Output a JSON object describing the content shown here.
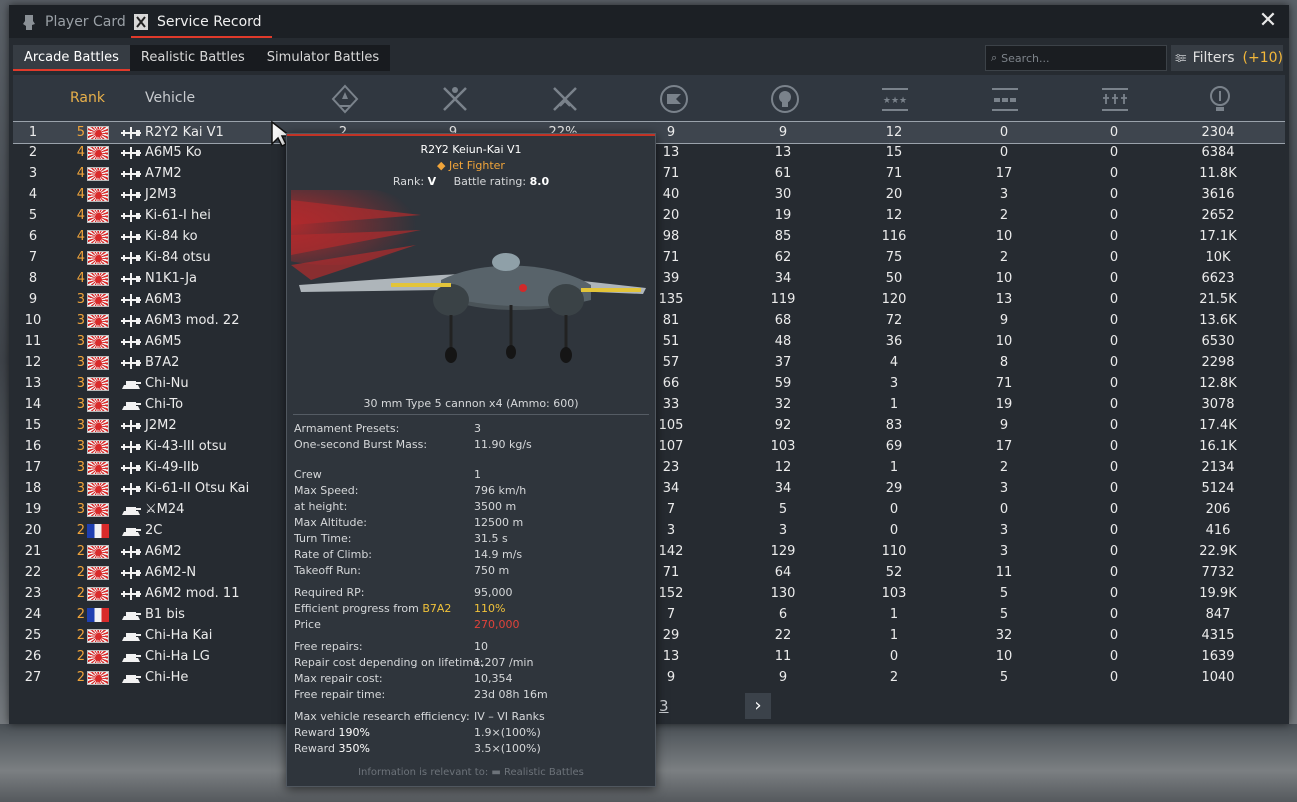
{
  "tabs": {
    "player_card": "Player Card",
    "service_record": "Service Record"
  },
  "modes": [
    "Arcade Battles",
    "Realistic Battles",
    "Simulator Battles"
  ],
  "search": {
    "placeholder": "Search..."
  },
  "filters": {
    "label": "Filters",
    "count": "(+10)"
  },
  "columns": {
    "rank": "Rank",
    "vehicle": "Vehicle",
    "icons": [
      "respawns-icon",
      "victories-icon",
      "win-rate-icon",
      "missions-icon",
      "deaths-icon",
      "air-kills-icon",
      "ground-kills-icon",
      "naval-kills-icon",
      "score-icon"
    ]
  },
  "colors": {
    "accent_red": "#e03a2b",
    "rank_orange": "#f0a43a",
    "filters_count": "#f4b83a"
  },
  "rows": [
    {
      "n": "1",
      "rank": "5",
      "flag": "jp",
      "type": "plane",
      "name": "R2Y2 Kai V1",
      "v": [
        "2",
        "9",
        "22%",
        "9",
        "9",
        "12",
        "0",
        "0",
        "2304"
      ]
    },
    {
      "n": "2",
      "rank": "4",
      "flag": "jp",
      "type": "plane",
      "name": "A6M5 Ko",
      "v": [
        "",
        "",
        "",
        "13",
        "13",
        "15",
        "0",
        "0",
        "6384"
      ]
    },
    {
      "n": "3",
      "rank": "4",
      "flag": "jp",
      "type": "plane",
      "name": "A7M2",
      "v": [
        "",
        "",
        "",
        "71",
        "61",
        "71",
        "17",
        "0",
        "11.8K"
      ]
    },
    {
      "n": "4",
      "rank": "4",
      "flag": "jp",
      "type": "plane",
      "name": "J2M3",
      "v": [
        "",
        "",
        "",
        "40",
        "30",
        "20",
        "3",
        "0",
        "3616"
      ]
    },
    {
      "n": "5",
      "rank": "4",
      "flag": "jp",
      "type": "plane",
      "name": "Ki-61-I hei",
      "v": [
        "",
        "",
        "",
        "20",
        "19",
        "12",
        "2",
        "0",
        "2652"
      ]
    },
    {
      "n": "6",
      "rank": "4",
      "flag": "jp",
      "type": "plane",
      "name": "Ki-84 ko",
      "v": [
        "",
        "",
        "",
        "98",
        "85",
        "116",
        "10",
        "0",
        "17.1K"
      ]
    },
    {
      "n": "7",
      "rank": "4",
      "flag": "jp",
      "type": "plane",
      "name": "Ki-84 otsu",
      "v": [
        "",
        "",
        "",
        "71",
        "62",
        "75",
        "2",
        "0",
        "10K"
      ]
    },
    {
      "n": "8",
      "rank": "4",
      "flag": "jp",
      "type": "plane",
      "name": "N1K1-Ja",
      "v": [
        "",
        "",
        "",
        "39",
        "34",
        "50",
        "10",
        "0",
        "6623"
      ]
    },
    {
      "n": "9",
      "rank": "3",
      "flag": "jp",
      "type": "plane",
      "name": "A6M3",
      "v": [
        "",
        "",
        "",
        "135",
        "119",
        "120",
        "13",
        "0",
        "21.5K"
      ]
    },
    {
      "n": "10",
      "rank": "3",
      "flag": "jp",
      "type": "plane",
      "name": "A6M3 mod. 22",
      "v": [
        "",
        "",
        "",
        "81",
        "68",
        "72",
        "9",
        "0",
        "13.6K"
      ]
    },
    {
      "n": "11",
      "rank": "3",
      "flag": "jp",
      "type": "plane",
      "name": "A6M5",
      "v": [
        "",
        "",
        "",
        "51",
        "48",
        "36",
        "10",
        "0",
        "6530"
      ]
    },
    {
      "n": "12",
      "rank": "3",
      "flag": "jp",
      "type": "plane",
      "name": "B7A2",
      "v": [
        "",
        "",
        "",
        "57",
        "37",
        "4",
        "8",
        "0",
        "2298"
      ]
    },
    {
      "n": "13",
      "rank": "3",
      "flag": "jp",
      "type": "tank",
      "name": "Chi-Nu",
      "v": [
        "",
        "",
        "",
        "66",
        "59",
        "3",
        "71",
        "0",
        "12.8K"
      ]
    },
    {
      "n": "14",
      "rank": "3",
      "flag": "jp",
      "type": "tank",
      "name": "Chi-To",
      "v": [
        "",
        "",
        "",
        "33",
        "32",
        "1",
        "19",
        "0",
        "3078"
      ]
    },
    {
      "n": "15",
      "rank": "3",
      "flag": "jp",
      "type": "plane",
      "name": "J2M2",
      "v": [
        "",
        "",
        "",
        "105",
        "92",
        "83",
        "9",
        "0",
        "17.4K"
      ]
    },
    {
      "n": "16",
      "rank": "3",
      "flag": "jp",
      "type": "plane",
      "name": "Ki-43-III otsu",
      "v": [
        "",
        "",
        "",
        "107",
        "103",
        "69",
        "17",
        "0",
        "16.1K"
      ]
    },
    {
      "n": "17",
      "rank": "3",
      "flag": "jp",
      "type": "plane",
      "name": "Ki-49-IIb",
      "v": [
        "",
        "",
        "",
        "23",
        "12",
        "1",
        "2",
        "0",
        "2134"
      ]
    },
    {
      "n": "18",
      "rank": "3",
      "flag": "jp",
      "type": "plane",
      "name": "Ki-61-II Otsu Kai",
      "v": [
        "",
        "",
        "",
        "34",
        "34",
        "29",
        "3",
        "0",
        "5124"
      ]
    },
    {
      "n": "19",
      "rank": "3",
      "flag": "jp",
      "type": "tank",
      "name": "⚔M24",
      "v": [
        "",
        "",
        "",
        "7",
        "5",
        "0",
        "0",
        "0",
        "206"
      ]
    },
    {
      "n": "20",
      "rank": "2",
      "flag": "fr",
      "type": "tank",
      "name": "2C",
      "v": [
        "",
        "",
        "",
        "3",
        "3",
        "0",
        "3",
        "0",
        "416"
      ]
    },
    {
      "n": "21",
      "rank": "2",
      "flag": "jp",
      "type": "plane",
      "name": "A6M2",
      "v": [
        "",
        "",
        "",
        "142",
        "129",
        "110",
        "3",
        "0",
        "22.9K"
      ]
    },
    {
      "n": "22",
      "rank": "2",
      "flag": "jp",
      "type": "plane",
      "name": "A6M2-N",
      "v": [
        "",
        "",
        "",
        "71",
        "64",
        "52",
        "11",
        "0",
        "7732"
      ]
    },
    {
      "n": "23",
      "rank": "2",
      "flag": "jp",
      "type": "plane",
      "name": "A6M2 mod. 11",
      "v": [
        "",
        "",
        "",
        "152",
        "130",
        "103",
        "5",
        "0",
        "19.9K"
      ]
    },
    {
      "n": "24",
      "rank": "2",
      "flag": "fr",
      "type": "tank",
      "name": "B1 bis",
      "v": [
        "",
        "",
        "",
        "7",
        "6",
        "1",
        "5",
        "0",
        "847"
      ]
    },
    {
      "n": "25",
      "rank": "2",
      "flag": "jp",
      "type": "tank",
      "name": "Chi-Ha Kai",
      "v": [
        "",
        "",
        "",
        "29",
        "22",
        "1",
        "32",
        "0",
        "4315"
      ]
    },
    {
      "n": "26",
      "rank": "2",
      "flag": "jp",
      "type": "tank",
      "name": "Chi-Ha LG",
      "v": [
        "",
        "",
        "",
        "13",
        "11",
        "0",
        "10",
        "0",
        "1639"
      ]
    },
    {
      "n": "27",
      "rank": "2",
      "flag": "jp",
      "type": "tank",
      "name": "Chi-He",
      "v": [
        "",
        "",
        "",
        "9",
        "9",
        "2",
        "5",
        "0",
        "1040"
      ]
    }
  ],
  "pager": {
    "page": "3",
    "next": "›"
  },
  "tooltip": {
    "title": "R2Y2 Keiun-Kai V1",
    "class": "◆ Jet Fighter",
    "rank_label": "Rank:",
    "rank": "V",
    "br_label": "Battle rating:",
    "br": "8.0",
    "weapon": "30 mm Type 5 cannon x4 (Ammo: 600)",
    "stats": [
      {
        "k": "Armament Presets:",
        "v": "3"
      },
      {
        "k": "One-second Burst Mass:",
        "v": "11.90 kg/s"
      },
      {
        "k": "Crew",
        "v": "1"
      },
      {
        "k": "Max Speed:",
        "v": "796 km/h"
      },
      {
        "k": "at height:",
        "v": "3500 m"
      },
      {
        "k": "Max Altitude:",
        "v": "12500 m"
      },
      {
        "k": "Turn Time:",
        "v": "31.5 s"
      },
      {
        "k": "Rate of Climb:",
        "v": "14.9 m/s"
      },
      {
        "k": "Takeoff Run:",
        "v": "750 m"
      }
    ],
    "research": [
      {
        "k": "Required RP:",
        "v": "95,000"
      },
      {
        "k": "Efficient progress from",
        "k2": "B7A2",
        "v": "110%"
      },
      {
        "k": "Price",
        "v": "270,000"
      }
    ],
    "repair": [
      {
        "k": "Free repairs:",
        "v": "10"
      },
      {
        "k": "Repair cost depending on lifetime:",
        "v": "1,207 /min"
      },
      {
        "k": "Max repair cost:",
        "v": "10,354"
      },
      {
        "k": "Free repair time:",
        "v": "23d 08h 16m"
      }
    ],
    "rewards": [
      {
        "k": "Max vehicle research efficiency:",
        "v": "IV – VI Ranks"
      },
      {
        "k": "Reward",
        "k2": "190%",
        "v": "1.9×(100%)"
      },
      {
        "k": "Reward",
        "k2": "350%",
        "v": "3.5×(100%)"
      }
    ],
    "footer": "Information is relevant to: ▬ Realistic Battles"
  }
}
